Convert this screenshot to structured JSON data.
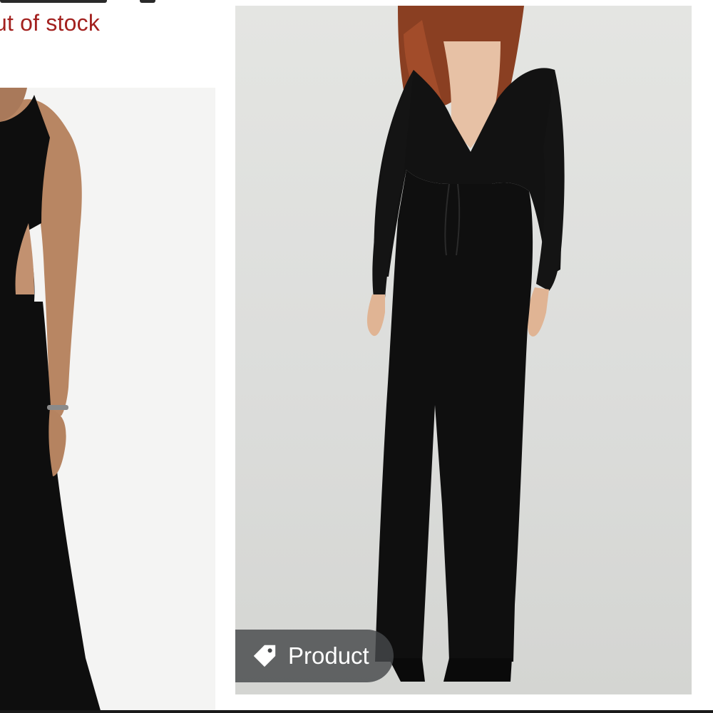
{
  "listing": {
    "stock_status": "ut of stock",
    "stock_status_color": "#a3211f"
  },
  "photos": [
    {
      "name": "left-product-photo",
      "description_icon": "image-icon"
    },
    {
      "name": "right-product-photo",
      "description_icon": "image-icon"
    }
  ],
  "badge": {
    "label": "Product",
    "icon": "tag-icon"
  }
}
